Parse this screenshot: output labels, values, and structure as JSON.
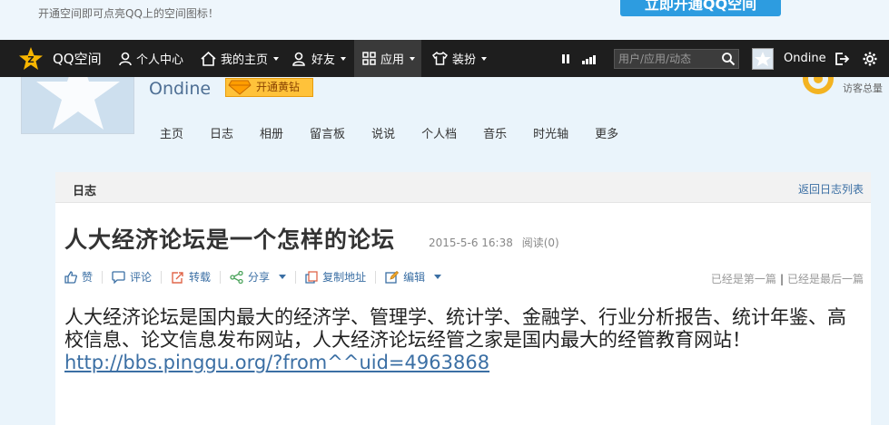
{
  "promo": {
    "text": "开通空间即可点亮QQ上的空间图标！",
    "button": "立即开通QQ空间"
  },
  "navbar": {
    "logo": "QQ空间",
    "items": [
      {
        "label": "个人中心",
        "icon": "person-icon"
      },
      {
        "label": "我的主页",
        "icon": "home-icon"
      },
      {
        "label": "好友",
        "icon": "friends-icon"
      },
      {
        "label": "应用",
        "icon": "apps-grid-icon"
      },
      {
        "label": "装扮",
        "icon": "shirt-icon"
      }
    ],
    "search_placeholder": "用户/应用/动态",
    "username": "Ondine"
  },
  "profile": {
    "name": "Ondine",
    "vip_button": "开通黄钻",
    "visit_total": "访客总量",
    "subnav": [
      "主页",
      "日志",
      "相册",
      "留言板",
      "说说",
      "个人档",
      "音乐",
      "时光轴",
      "更多"
    ]
  },
  "blog": {
    "section_title": "日志",
    "back_link": "返回日志列表",
    "title": "人大经济论坛是一个怎样的论坛",
    "date": "2015-5-6 16:38",
    "reads": "阅读(0)",
    "actions": {
      "like": "赞",
      "comment": "评论",
      "repost": "转载",
      "share": "分享",
      "copy": "复制地址",
      "edit": "编辑"
    },
    "first_post": "已经是第一篇",
    "separator": "|",
    "last_post": "已经是最后一篇",
    "content_text": "人大经济论坛是国内最大的经济学、管理学、统计学、金融学、行业分析报告、统计年鉴、高校信息、论文信息发布网站，人大经济论坛经管之家是国内最大的经管教育网站！",
    "content_link": "http://bbs.pinggu.org/?from^^uid=4963868"
  },
  "colors": {
    "navbar_bg": "#1e1e1e",
    "link": "#3b6fa4",
    "accent": "#2d9ce0",
    "vip": "#ffc23a"
  }
}
